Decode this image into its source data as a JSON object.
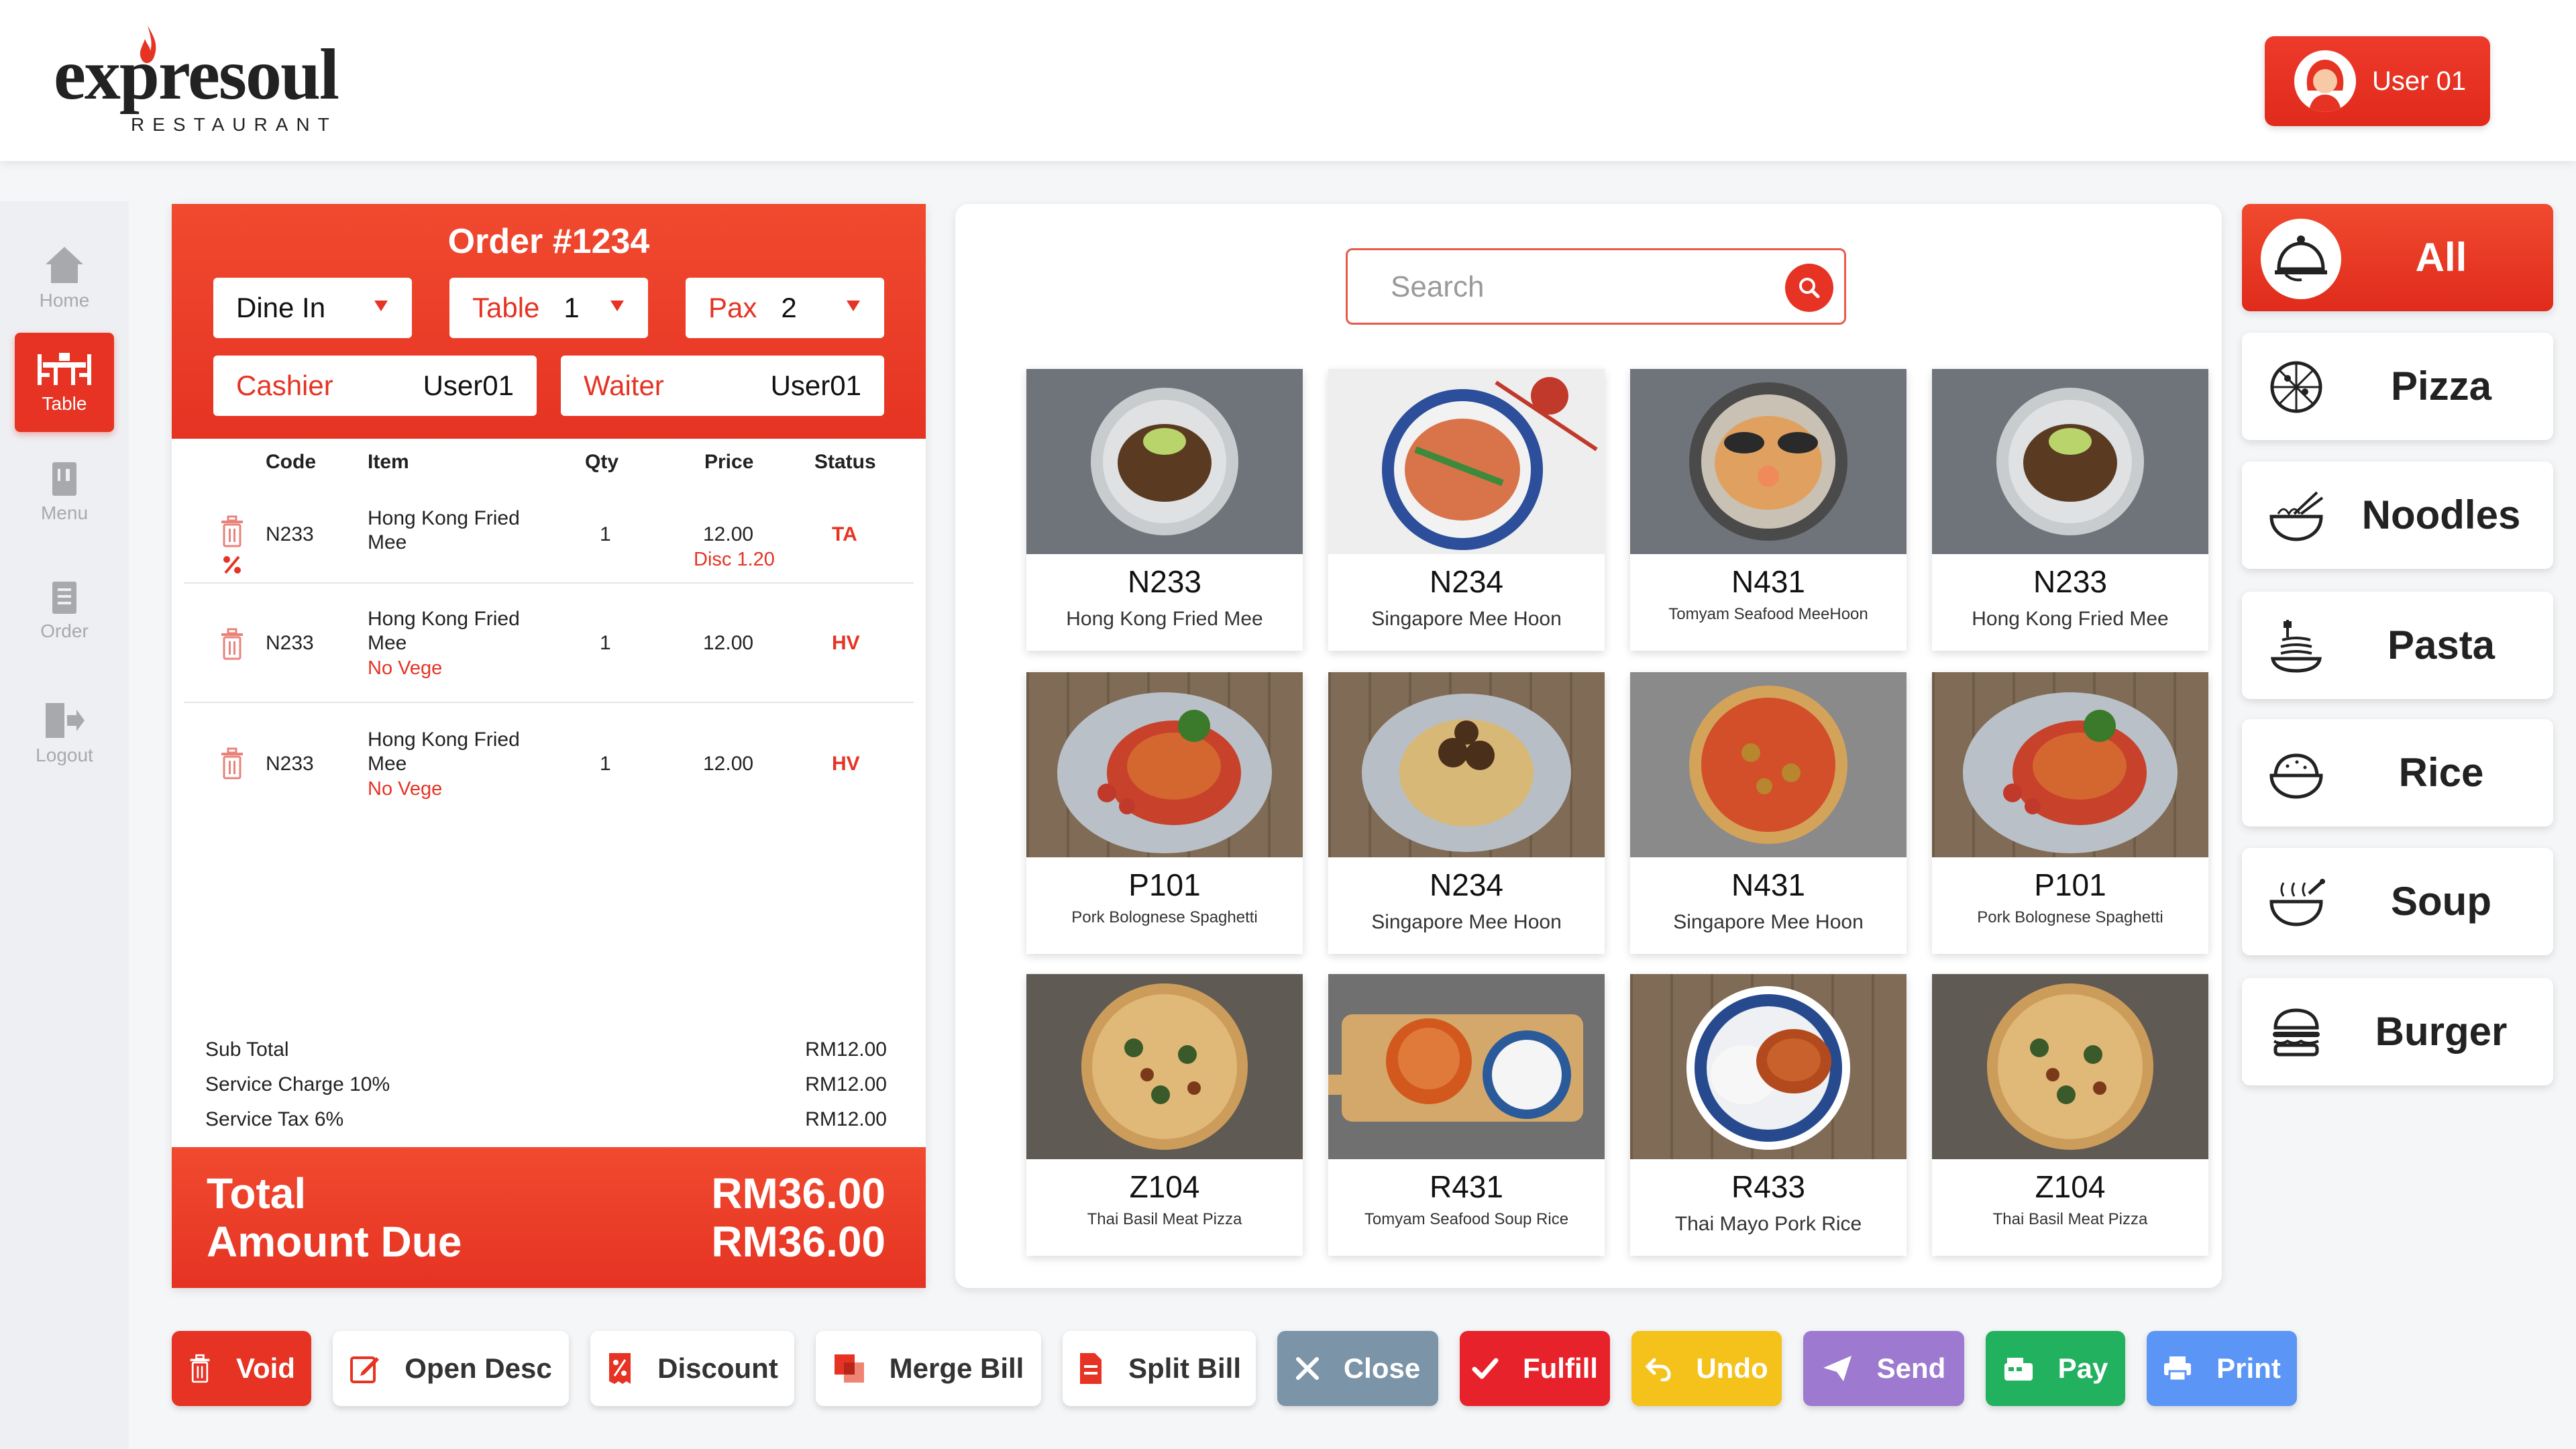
{
  "app": {
    "logo_text": "expresoul",
    "logo_subtitle": "RESTAURANT",
    "user_label": "User 01"
  },
  "sidebar": [
    {
      "label": "Home",
      "active": false
    },
    {
      "label": "Table",
      "active": true
    },
    {
      "label": "Menu",
      "active": false
    },
    {
      "label": "Order",
      "active": false
    },
    {
      "label": "Logout",
      "active": false
    }
  ],
  "order": {
    "title": "Order #1234",
    "dine_type": "Dine In",
    "table_label": "Table",
    "table_value": "1",
    "pax_label": "Pax",
    "pax_value": "2",
    "cashier_label": "Cashier",
    "cashier_value": "User01",
    "waiter_label": "Waiter",
    "waiter_value": "User01",
    "columns": {
      "code": "Code",
      "item": "Item",
      "qty": "Qty",
      "price": "Price",
      "status": "Status"
    },
    "items": [
      {
        "code": "N233",
        "item_l1": "Hong Kong Fried",
        "item_l2": "Mee",
        "note": "",
        "qty": "1",
        "price": "12.00",
        "disc": "Disc 1.20",
        "status": "TA"
      },
      {
        "code": "N233",
        "item_l1": "Hong Kong Fried",
        "item_l2": "Mee",
        "note": "No Vege",
        "qty": "1",
        "price": "12.00",
        "disc": "",
        "status": "HV"
      },
      {
        "code": "N233",
        "item_l1": "Hong Kong Fried",
        "item_l2": "Mee",
        "note": "No Vege",
        "qty": "1",
        "price": "12.00",
        "disc": "",
        "status": "HV"
      }
    ],
    "summary": [
      {
        "label": "Sub Total",
        "value": "RM12.00"
      },
      {
        "label": "Service Charge 10%",
        "value": "RM12.00"
      },
      {
        "label": "Service Tax 6%",
        "value": "RM12.00"
      }
    ],
    "total_label": "Total",
    "total_value": "RM36.00",
    "due_label": "Amount Due",
    "due_value": "RM36.00"
  },
  "search": {
    "placeholder": "Search"
  },
  "menu_items": [
    {
      "code": "N233",
      "name": "Hong Kong Fried Mee",
      "dish": "noodle-green"
    },
    {
      "code": "N234",
      "name": "Singapore Mee Hoon",
      "dish": "noodle-blue"
    },
    {
      "code": "N431",
      "name": "Tomyam Seafood MeeHoon",
      "dish": "seafood"
    },
    {
      "code": "N233",
      "name": "Hong Kong Fried Mee",
      "dish": "noodle-green"
    },
    {
      "code": "P101",
      "name": "Pork Bolognese Spaghetti",
      "dish": "spaghetti"
    },
    {
      "code": "N234",
      "name": "Singapore Mee Hoon",
      "dish": "meatball"
    },
    {
      "code": "N431",
      "name": "Singapore Mee Hoon",
      "dish": "pizza-red"
    },
    {
      "code": "P101",
      "name": "Pork Bolognese Spaghetti",
      "dish": "spaghetti"
    },
    {
      "code": "Z104",
      "name": "Thai Basil Meat Pizza",
      "dish": "pizza"
    },
    {
      "code": "R431",
      "name": "Tomyam Seafood Soup Rice",
      "dish": "soup-rice"
    },
    {
      "code": "R433",
      "name": "Thai Mayo Pork Rice",
      "dish": "rice-blue"
    },
    {
      "code": "Z104",
      "name": "Thai Basil Meat Pizza",
      "dish": "pizza"
    }
  ],
  "categories": [
    {
      "label": "All",
      "icon": "cloche-icon",
      "active": true
    },
    {
      "label": "Pizza",
      "icon": "pizza-icon",
      "active": false
    },
    {
      "label": "Noodles",
      "icon": "noodles-icon",
      "active": false
    },
    {
      "label": "Pasta",
      "icon": "pasta-icon",
      "active": false
    },
    {
      "label": "Rice",
      "icon": "rice-icon",
      "active": false
    },
    {
      "label": "Soup",
      "icon": "soup-icon",
      "active": false
    },
    {
      "label": "Burger",
      "icon": "burger-icon",
      "active": false
    }
  ],
  "actions": [
    {
      "label": "Void",
      "style": "red",
      "color": "#e63323",
      "icon": "trash-icon"
    },
    {
      "label": "Open Desc",
      "style": "white",
      "color": "#ffffff",
      "icon": "edit-icon"
    },
    {
      "label": "Discount",
      "style": "white",
      "color": "#ffffff",
      "icon": "discount-icon"
    },
    {
      "label": "Merge Bill",
      "style": "white",
      "color": "#ffffff",
      "icon": "merge-icon"
    },
    {
      "label": "Split Bill",
      "style": "white",
      "color": "#ffffff",
      "icon": "split-icon"
    },
    {
      "label": "Close",
      "style": "col",
      "color": "#7b94a8",
      "icon": "close-icon"
    },
    {
      "label": "Fulfill",
      "style": "col",
      "color": "#e8222b",
      "icon": "check-icon"
    },
    {
      "label": "Undo",
      "style": "col",
      "color": "#f5c21b",
      "icon": "undo-icon"
    },
    {
      "label": "Send",
      "style": "col",
      "color": "#9d7ad0",
      "icon": "send-icon"
    },
    {
      "label": "Pay",
      "style": "col",
      "color": "#22b15f",
      "icon": "pay-icon"
    },
    {
      "label": "Print",
      "style": "col",
      "color": "#5b95f5",
      "icon": "print-icon"
    }
  ],
  "colors": {
    "accent": "#e63323",
    "background": "#f5f6f8"
  }
}
